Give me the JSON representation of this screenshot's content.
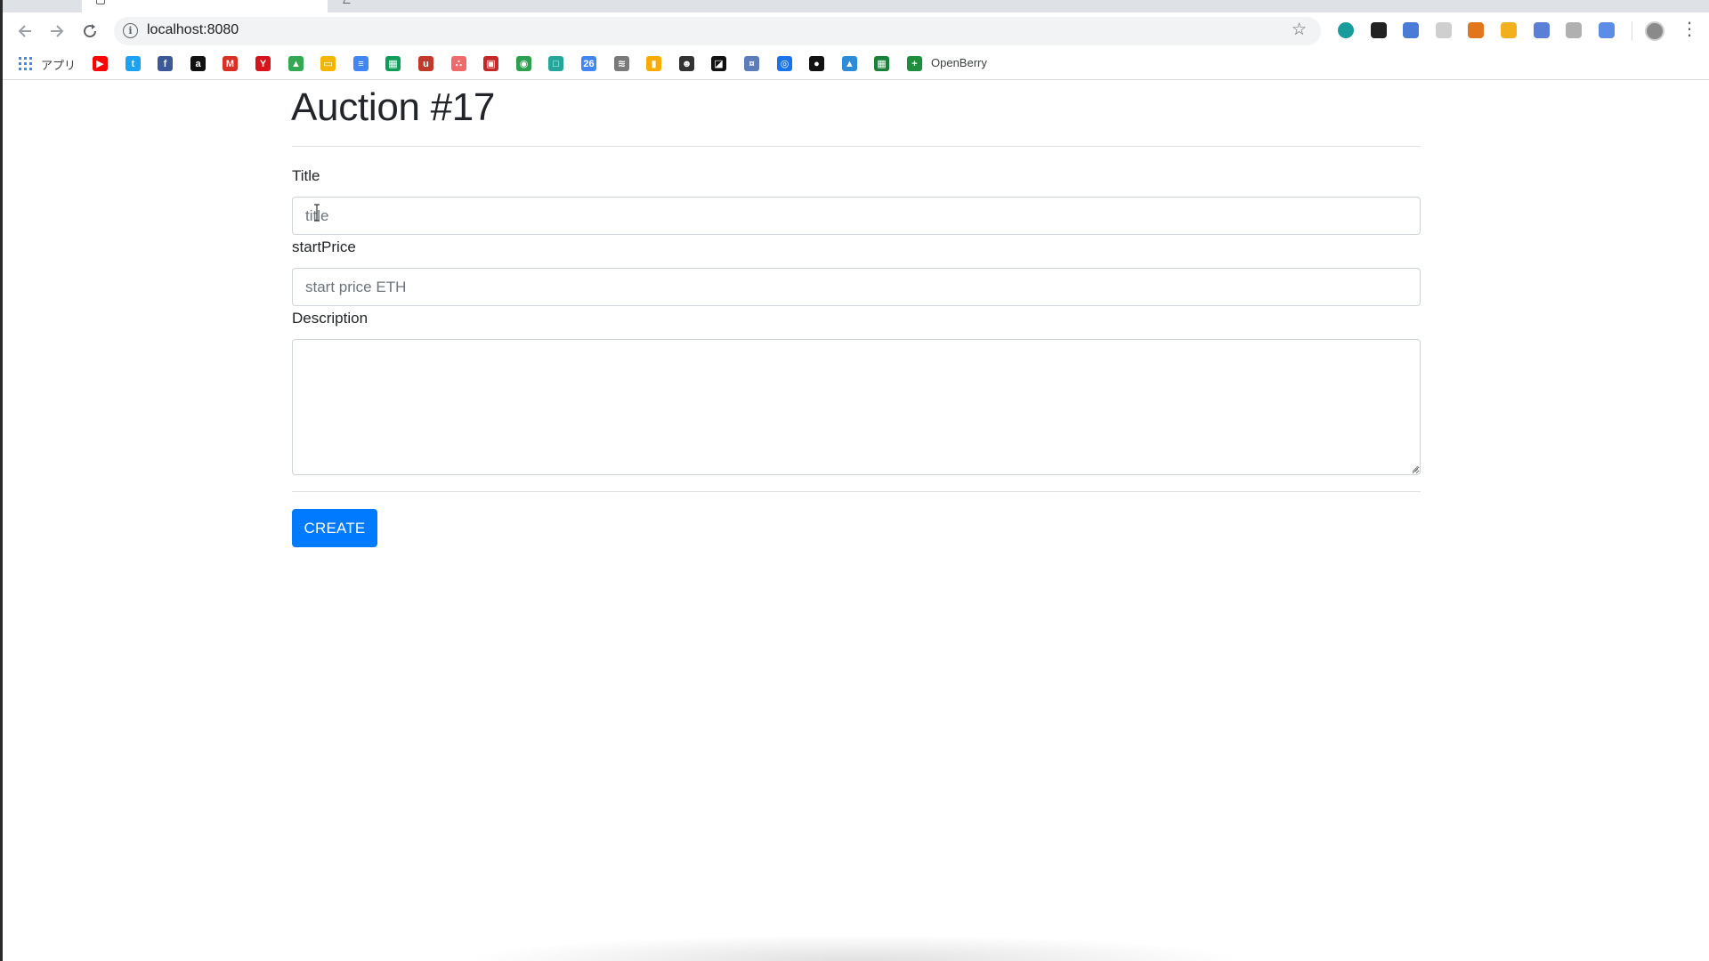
{
  "browser": {
    "url": "localhost:8080",
    "apps_label": "アプリ",
    "bookmark_folder_label": "OpenBerry",
    "bookmark_icons": [
      {
        "name": "youtube-icon",
        "color": "#ff0000",
        "glyph": "▶"
      },
      {
        "name": "twitter-icon",
        "color": "#1da1f2",
        "glyph": "t"
      },
      {
        "name": "facebook-icon",
        "color": "#3b5998",
        "glyph": "f"
      },
      {
        "name": "amazon-icon",
        "color": "#111111",
        "glyph": "a"
      },
      {
        "name": "gmail-icon",
        "color": "#d93025",
        "glyph": "M"
      },
      {
        "name": "yahoo-icon",
        "color": "#d7131c",
        "glyph": "Y"
      },
      {
        "name": "google-drive-icon",
        "color": "#34a853",
        "glyph": "▲"
      },
      {
        "name": "google-slides-icon",
        "color": "#f4b400",
        "glyph": "▭"
      },
      {
        "name": "google-docs-icon",
        "color": "#4285f4",
        "glyph": "≡"
      },
      {
        "name": "google-sheets-icon",
        "color": "#0f9d58",
        "glyph": "▦"
      },
      {
        "name": "udemy-icon",
        "color": "#c0392b",
        "glyph": "u"
      },
      {
        "name": "asana-icon",
        "color": "#f06a6a",
        "glyph": "∴"
      },
      {
        "name": "red-app-icon",
        "color": "#c62828",
        "glyph": "▣"
      },
      {
        "name": "green-circle-icon",
        "color": "#2e9e4f",
        "glyph": "◉"
      },
      {
        "name": "teal-app-icon",
        "color": "#26a69a",
        "glyph": "□"
      },
      {
        "name": "google-calendar-icon",
        "color": "#4285f4",
        "glyph": "26"
      },
      {
        "name": "wifi-app-icon",
        "color": "#7a7a7a",
        "glyph": "≋"
      },
      {
        "name": "analytics-icon",
        "color": "#f9ab00",
        "glyph": "▮"
      },
      {
        "name": "mascot-icon",
        "color": "#333333",
        "glyph": "☻"
      },
      {
        "name": "black-frame-icon",
        "color": "#111111",
        "glyph": "◪"
      },
      {
        "name": "blue-text-app-icon",
        "color": "#5c7cba",
        "glyph": "¤"
      },
      {
        "name": "blue-ring-icon",
        "color": "#1a73e8",
        "glyph": "◎"
      },
      {
        "name": "github-icon",
        "color": "#111111",
        "glyph": "●"
      },
      {
        "name": "image-app-icon",
        "color": "#2d8cd8",
        "glyph": "▲"
      },
      {
        "name": "green-sheet-icon",
        "color": "#188038",
        "glyph": "▦"
      },
      {
        "name": "openberry-plus-icon",
        "color": "#1e8e3e",
        "glyph": "+"
      }
    ],
    "extension_icons": [
      {
        "name": "teal-circle-extension-icon",
        "color": "#1a9c9c"
      },
      {
        "name": "square-frame-extension-icon",
        "color": "#222222"
      },
      {
        "name": "translate-extension-icon",
        "color": "#4a7bd6"
      },
      {
        "name": "chat-extension-icon",
        "color": "#cfcfcf"
      },
      {
        "name": "metamask-extension-icon",
        "color": "#e2761b"
      },
      {
        "name": "w-extension-icon",
        "color": "#f2b01e"
      },
      {
        "name": "blue-circle-extension-icon",
        "color": "#5b7fd6"
      },
      {
        "name": "cloud-extension-icon",
        "color": "#b0b0b0"
      },
      {
        "name": "feather-extension-icon",
        "color": "#5b8de6"
      }
    ]
  },
  "page": {
    "title": "Auction #17",
    "form": {
      "title_label": "Title",
      "title_placeholder": "title",
      "title_value": "",
      "start_price_label": "startPrice",
      "start_price_placeholder": "start price ETH",
      "start_price_value": "",
      "description_label": "Description",
      "description_value": "",
      "create_label": "CREATE"
    }
  },
  "theme": {
    "primary": "#007bff",
    "text": "#212529",
    "border": "#ced4da"
  }
}
